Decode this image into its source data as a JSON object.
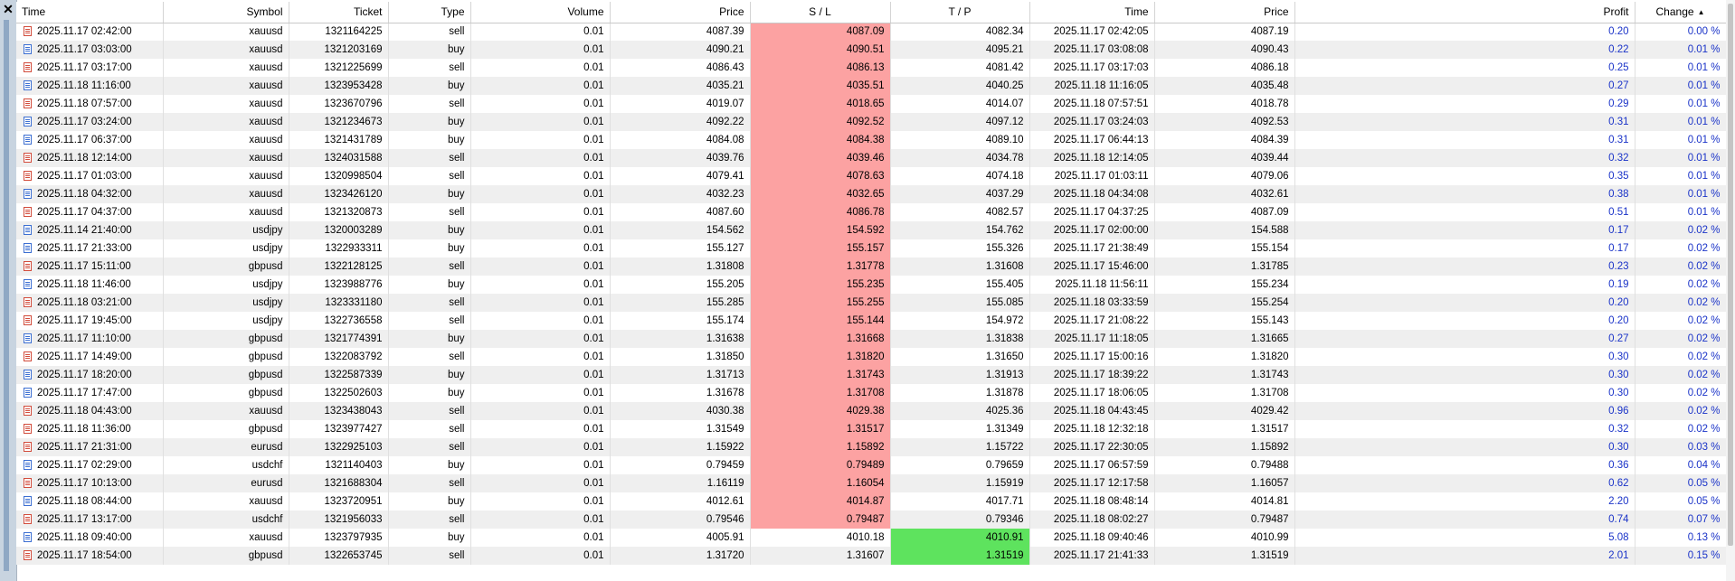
{
  "close_glyph": "✕",
  "columns": [
    "Time",
    "Symbol",
    "Ticket",
    "Type",
    "Volume",
    "Price",
    "S / L",
    "T / P",
    "Time",
    "Price",
    "Profit",
    "Change"
  ],
  "sort_column": "Change",
  "sort_glyph": "▲",
  "colors": {
    "sl_highlight": "#fca2a2",
    "tp_highlight": "#5ee35e",
    "profit_text": "#1a33c8"
  },
  "rows": [
    {
      "open_time": "2025.11.17 02:42:00",
      "symbol": "xauusd",
      "ticket": "1321164225",
      "type": "sell",
      "volume": "0.01",
      "price": "4087.39",
      "sl": "4087.09",
      "tp": "4082.34",
      "close_time": "2025.11.17 02:42:05",
      "close_price": "4087.19",
      "profit": "0.20",
      "change": "0.00 %",
      "hit": "sl"
    },
    {
      "open_time": "2025.11.17 03:03:00",
      "symbol": "xauusd",
      "ticket": "1321203169",
      "type": "buy",
      "volume": "0.01",
      "price": "4090.21",
      "sl": "4090.51",
      "tp": "4095.21",
      "close_time": "2025.11.17 03:08:08",
      "close_price": "4090.43",
      "profit": "0.22",
      "change": "0.01 %",
      "hit": "sl"
    },
    {
      "open_time": "2025.11.17 03:17:00",
      "symbol": "xauusd",
      "ticket": "1321225699",
      "type": "sell",
      "volume": "0.01",
      "price": "4086.43",
      "sl": "4086.13",
      "tp": "4081.42",
      "close_time": "2025.11.17 03:17:03",
      "close_price": "4086.18",
      "profit": "0.25",
      "change": "0.01 %",
      "hit": "sl"
    },
    {
      "open_time": "2025.11.18 11:16:00",
      "symbol": "xauusd",
      "ticket": "1323953428",
      "type": "buy",
      "volume": "0.01",
      "price": "4035.21",
      "sl": "4035.51",
      "tp": "4040.25",
      "close_time": "2025.11.18 11:16:05",
      "close_price": "4035.48",
      "profit": "0.27",
      "change": "0.01 %",
      "hit": "sl"
    },
    {
      "open_time": "2025.11.18 07:57:00",
      "symbol": "xauusd",
      "ticket": "1323670796",
      "type": "sell",
      "volume": "0.01",
      "price": "4019.07",
      "sl": "4018.65",
      "tp": "4014.07",
      "close_time": "2025.11.18 07:57:51",
      "close_price": "4018.78",
      "profit": "0.29",
      "change": "0.01 %",
      "hit": "sl"
    },
    {
      "open_time": "2025.11.17 03:24:00",
      "symbol": "xauusd",
      "ticket": "1321234673",
      "type": "buy",
      "volume": "0.01",
      "price": "4092.22",
      "sl": "4092.52",
      "tp": "4097.12",
      "close_time": "2025.11.17 03:24:03",
      "close_price": "4092.53",
      "profit": "0.31",
      "change": "0.01 %",
      "hit": "sl"
    },
    {
      "open_time": "2025.11.17 06:37:00",
      "symbol": "xauusd",
      "ticket": "1321431789",
      "type": "buy",
      "volume": "0.01",
      "price": "4084.08",
      "sl": "4084.38",
      "tp": "4089.10",
      "close_time": "2025.11.17 06:44:13",
      "close_price": "4084.39",
      "profit": "0.31",
      "change": "0.01 %",
      "hit": "sl"
    },
    {
      "open_time": "2025.11.18 12:14:00",
      "symbol": "xauusd",
      "ticket": "1324031588",
      "type": "sell",
      "volume": "0.01",
      "price": "4039.76",
      "sl": "4039.46",
      "tp": "4034.78",
      "close_time": "2025.11.18 12:14:05",
      "close_price": "4039.44",
      "profit": "0.32",
      "change": "0.01 %",
      "hit": "sl"
    },
    {
      "open_time": "2025.11.17 01:03:00",
      "symbol": "xauusd",
      "ticket": "1320998504",
      "type": "sell",
      "volume": "0.01",
      "price": "4079.41",
      "sl": "4078.63",
      "tp": "4074.18",
      "close_time": "2025.11.17 01:03:11",
      "close_price": "4079.06",
      "profit": "0.35",
      "change": "0.01 %",
      "hit": "sl"
    },
    {
      "open_time": "2025.11.18 04:32:00",
      "symbol": "xauusd",
      "ticket": "1323426120",
      "type": "buy",
      "volume": "0.01",
      "price": "4032.23",
      "sl": "4032.65",
      "tp": "4037.29",
      "close_time": "2025.11.18 04:34:08",
      "close_price": "4032.61",
      "profit": "0.38",
      "change": "0.01 %",
      "hit": "sl"
    },
    {
      "open_time": "2025.11.17 04:37:00",
      "symbol": "xauusd",
      "ticket": "1321320873",
      "type": "sell",
      "volume": "0.01",
      "price": "4087.60",
      "sl": "4086.78",
      "tp": "4082.57",
      "close_time": "2025.11.17 04:37:25",
      "close_price": "4087.09",
      "profit": "0.51",
      "change": "0.01 %",
      "hit": "sl"
    },
    {
      "open_time": "2025.11.14 21:40:00",
      "symbol": "usdjpy",
      "ticket": "1320003289",
      "type": "buy",
      "volume": "0.01",
      "price": "154.562",
      "sl": "154.592",
      "tp": "154.762",
      "close_time": "2025.11.17 02:00:00",
      "close_price": "154.588",
      "profit": "0.17",
      "change": "0.02 %",
      "hit": "sl"
    },
    {
      "open_time": "2025.11.17 21:33:00",
      "symbol": "usdjpy",
      "ticket": "1322933311",
      "type": "buy",
      "volume": "0.01",
      "price": "155.127",
      "sl": "155.157",
      "tp": "155.326",
      "close_time": "2025.11.17 21:38:49",
      "close_price": "155.154",
      "profit": "0.17",
      "change": "0.02 %",
      "hit": "sl"
    },
    {
      "open_time": "2025.11.17 15:11:00",
      "symbol": "gbpusd",
      "ticket": "1322128125",
      "type": "sell",
      "volume": "0.01",
      "price": "1.31808",
      "sl": "1.31778",
      "tp": "1.31608",
      "close_time": "2025.11.17 15:46:00",
      "close_price": "1.31785",
      "profit": "0.23",
      "change": "0.02 %",
      "hit": "sl"
    },
    {
      "open_time": "2025.11.18 11:46:00",
      "symbol": "usdjpy",
      "ticket": "1323988776",
      "type": "buy",
      "volume": "0.01",
      "price": "155.205",
      "sl": "155.235",
      "tp": "155.405",
      "close_time": "2025.11.18 11:56:11",
      "close_price": "155.234",
      "profit": "0.19",
      "change": "0.02 %",
      "hit": "sl"
    },
    {
      "open_time": "2025.11.18 03:21:00",
      "symbol": "usdjpy",
      "ticket": "1323331180",
      "type": "sell",
      "volume": "0.01",
      "price": "155.285",
      "sl": "155.255",
      "tp": "155.085",
      "close_time": "2025.11.18 03:33:59",
      "close_price": "155.254",
      "profit": "0.20",
      "change": "0.02 %",
      "hit": "sl"
    },
    {
      "open_time": "2025.11.17 19:45:00",
      "symbol": "usdjpy",
      "ticket": "1322736558",
      "type": "sell",
      "volume": "0.01",
      "price": "155.174",
      "sl": "155.144",
      "tp": "154.972",
      "close_time": "2025.11.17 21:08:22",
      "close_price": "155.143",
      "profit": "0.20",
      "change": "0.02 %",
      "hit": "sl"
    },
    {
      "open_time": "2025.11.17 11:10:00",
      "symbol": "gbpusd",
      "ticket": "1321774391",
      "type": "buy",
      "volume": "0.01",
      "price": "1.31638",
      "sl": "1.31668",
      "tp": "1.31838",
      "close_time": "2025.11.17 11:18:05",
      "close_price": "1.31665",
      "profit": "0.27",
      "change": "0.02 %",
      "hit": "sl"
    },
    {
      "open_time": "2025.11.17 14:49:00",
      "symbol": "gbpusd",
      "ticket": "1322083792",
      "type": "sell",
      "volume": "0.01",
      "price": "1.31850",
      "sl": "1.31820",
      "tp": "1.31650",
      "close_time": "2025.11.17 15:00:16",
      "close_price": "1.31820",
      "profit": "0.30",
      "change": "0.02 %",
      "hit": "sl"
    },
    {
      "open_time": "2025.11.17 18:20:00",
      "symbol": "gbpusd",
      "ticket": "1322587339",
      "type": "buy",
      "volume": "0.01",
      "price": "1.31713",
      "sl": "1.31743",
      "tp": "1.31913",
      "close_time": "2025.11.17 18:39:22",
      "close_price": "1.31743",
      "profit": "0.30",
      "change": "0.02 %",
      "hit": "sl"
    },
    {
      "open_time": "2025.11.17 17:47:00",
      "symbol": "gbpusd",
      "ticket": "1322502603",
      "type": "buy",
      "volume": "0.01",
      "price": "1.31678",
      "sl": "1.31708",
      "tp": "1.31878",
      "close_time": "2025.11.17 18:06:05",
      "close_price": "1.31708",
      "profit": "0.30",
      "change": "0.02 %",
      "hit": "sl"
    },
    {
      "open_time": "2025.11.18 04:43:00",
      "symbol": "xauusd",
      "ticket": "1323438043",
      "type": "sell",
      "volume": "0.01",
      "price": "4030.38",
      "sl": "4029.38",
      "tp": "4025.36",
      "close_time": "2025.11.18 04:43:45",
      "close_price": "4029.42",
      "profit": "0.96",
      "change": "0.02 %",
      "hit": "sl"
    },
    {
      "open_time": "2025.11.18 11:36:00",
      "symbol": "gbpusd",
      "ticket": "1323977427",
      "type": "sell",
      "volume": "0.01",
      "price": "1.31549",
      "sl": "1.31517",
      "tp": "1.31349",
      "close_time": "2025.11.18 12:32:18",
      "close_price": "1.31517",
      "profit": "0.32",
      "change": "0.02 %",
      "hit": "sl"
    },
    {
      "open_time": "2025.11.17 21:31:00",
      "symbol": "eurusd",
      "ticket": "1322925103",
      "type": "sell",
      "volume": "0.01",
      "price": "1.15922",
      "sl": "1.15892",
      "tp": "1.15722",
      "close_time": "2025.11.17 22:30:05",
      "close_price": "1.15892",
      "profit": "0.30",
      "change": "0.03 %",
      "hit": "sl"
    },
    {
      "open_time": "2025.11.17 02:29:00",
      "symbol": "usdchf",
      "ticket": "1321140403",
      "type": "buy",
      "volume": "0.01",
      "price": "0.79459",
      "sl": "0.79489",
      "tp": "0.79659",
      "close_time": "2025.11.17 06:57:59",
      "close_price": "0.79488",
      "profit": "0.36",
      "change": "0.04 %",
      "hit": "sl"
    },
    {
      "open_time": "2025.11.17 10:13:00",
      "symbol": "eurusd",
      "ticket": "1321688304",
      "type": "sell",
      "volume": "0.01",
      "price": "1.16119",
      "sl": "1.16054",
      "tp": "1.15919",
      "close_time": "2025.11.17 12:17:58",
      "close_price": "1.16057",
      "profit": "0.62",
      "change": "0.05 %",
      "hit": "sl"
    },
    {
      "open_time": "2025.11.18 08:44:00",
      "symbol": "xauusd",
      "ticket": "1323720951",
      "type": "buy",
      "volume": "0.01",
      "price": "4012.61",
      "sl": "4014.87",
      "tp": "4017.71",
      "close_time": "2025.11.18 08:48:14",
      "close_price": "4014.81",
      "profit": "2.20",
      "change": "0.05 %",
      "hit": "sl"
    },
    {
      "open_time": "2025.11.17 13:17:00",
      "symbol": "usdchf",
      "ticket": "1321956033",
      "type": "sell",
      "volume": "0.01",
      "price": "0.79546",
      "sl": "0.79487",
      "tp": "0.79346",
      "close_time": "2025.11.18 08:02:27",
      "close_price": "0.79487",
      "profit": "0.74",
      "change": "0.07 %",
      "hit": "sl"
    },
    {
      "open_time": "2025.11.18 09:40:00",
      "symbol": "xauusd",
      "ticket": "1323797935",
      "type": "buy",
      "volume": "0.01",
      "price": "4005.91",
      "sl": "4010.18",
      "tp": "4010.91",
      "close_time": "2025.11.18 09:40:46",
      "close_price": "4010.99",
      "profit": "5.08",
      "change": "0.13 %",
      "hit": "tp"
    },
    {
      "open_time": "2025.11.17 18:54:00",
      "symbol": "gbpusd",
      "ticket": "1322653745",
      "type": "sell",
      "volume": "0.01",
      "price": "1.31720",
      "sl": "1.31607",
      "tp": "1.31519",
      "close_time": "2025.11.17 21:41:33",
      "close_price": "1.31519",
      "profit": "2.01",
      "change": "0.15 %",
      "hit": "tp"
    }
  ]
}
